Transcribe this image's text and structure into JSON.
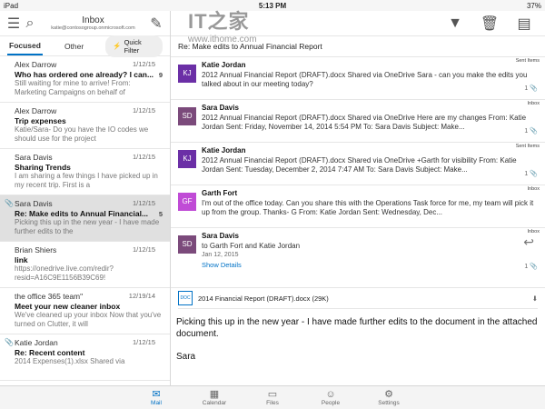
{
  "status": {
    "device": "iPad",
    "time": "5:13 PM",
    "battery": "37%"
  },
  "left": {
    "title": "Inbox",
    "account": "katie@contosogroup.onmicrosoft.com",
    "tabs": [
      "Focused",
      "Other"
    ],
    "quick_filter": "Quick Filter",
    "messages": [
      {
        "sender": "Alex Darrow",
        "date": "1/12/15",
        "count": "9",
        "subject": "Who has ordered one already? I can...",
        "preview": "Still waiting for mine to arrive! From: Marketing Campaigns on behalf of"
      },
      {
        "sender": "Alex Darrow",
        "date": "1/12/15",
        "count": "",
        "subject": "Trip expenses",
        "preview": "Katie/Sara- Do you have the IO codes we should use for the project"
      },
      {
        "sender": "Sara Davis",
        "date": "1/12/15",
        "count": "",
        "subject": "Sharing Trends",
        "preview": "I am sharing a few things I have picked up in my recent trip. First is a"
      },
      {
        "sender": "Sara Davis",
        "date": "1/12/15",
        "count": "5",
        "subject": "Re: Make edits to Annual Financial...",
        "preview": "Picking this up in the new year - I have made further edits to the"
      },
      {
        "sender": "Brian Shiers",
        "date": "1/12/15",
        "count": "",
        "subject": "link",
        "preview": "https://onedrive.live.com/redir?resid=A16C9E1156B39C69!"
      },
      {
        "sender": "the office 365 team\"",
        "date": "12/19/14",
        "count": "",
        "subject": "Meet your new cleaner inbox",
        "preview": "We've cleaned up your inbox Now that you've turned on Clutter, it will"
      },
      {
        "sender": "Katie Jordan",
        "date": "1/12/15",
        "count": "",
        "subject": "Re: Recent content",
        "preview": "2014 Expenses(1).xlsx Shared via"
      }
    ]
  },
  "right": {
    "subject": "Re: Make edits to Annual Financial Report",
    "threads": [
      {
        "initials": "KJ",
        "color": "#6b2fa6",
        "name": "Katie Jordan",
        "tag": "Sent Items",
        "count": "1",
        "body": "2012 Annual Financial Report (DRAFT).docx Shared via OneDrive Sara - can you make the edits you talked about in our meeting today?"
      },
      {
        "initials": "SD",
        "color": "#7b4a7b",
        "name": "Sara Davis",
        "tag": "Inbox",
        "count": "1",
        "body": "2012 Annual Financial Report (DRAFT).docx Shared via OneDrive Here are my changes From: Katie Jordan Sent: Friday, November 14, 2014 5:54 PM To: Sara Davis Subject: Make..."
      },
      {
        "initials": "KJ",
        "color": "#6b2fa6",
        "name": "Katie Jordan",
        "tag": "Sent Items",
        "count": "1",
        "body": "2012 Annual Financial Report (DRAFT).docx Shared via OneDrive +Garth for visibility From: Katie Jordan Sent: Tuesday, December 2, 2014 7:47 AM To: Sara Davis Subject: Make..."
      },
      {
        "initials": "GF",
        "color": "#c04bd6",
        "name": "Garth Fort",
        "tag": "Inbox",
        "count": "",
        "body": "I'm out of the office today. Can you share this with the Operations Task force for me, my team will pick it up from the group. Thanks- G From: Katie Jordan Sent: Wednesday, Dec..."
      }
    ],
    "expanded": {
      "initials": "SD",
      "color": "#7b4a7b",
      "name": "Sara Davis",
      "tag": "Inbox",
      "to": "to Garth Fort and Katie Jordan",
      "date": "Jan 12, 2015",
      "details": "Show Details",
      "count": "1"
    },
    "attachment": {
      "icon_text": "DOC",
      "name": "2014 Financial Report (DRAFT).docx (29K)"
    },
    "body": [
      "Picking this up in the new year - I have made further edits to the document in the attached document.",
      "Sara"
    ]
  },
  "watermark": {
    "logo": "IT之家",
    "url": "www.ithome.com"
  },
  "tabbar": [
    {
      "label": "Mail",
      "icon": "mail-icon",
      "active": true
    },
    {
      "label": "Calendar",
      "icon": "calendar-icon",
      "active": false
    },
    {
      "label": "Files",
      "icon": "files-icon",
      "active": false
    },
    {
      "label": "People",
      "icon": "people-icon",
      "active": false
    },
    {
      "label": "Settings",
      "icon": "settings-icon",
      "active": false
    }
  ]
}
